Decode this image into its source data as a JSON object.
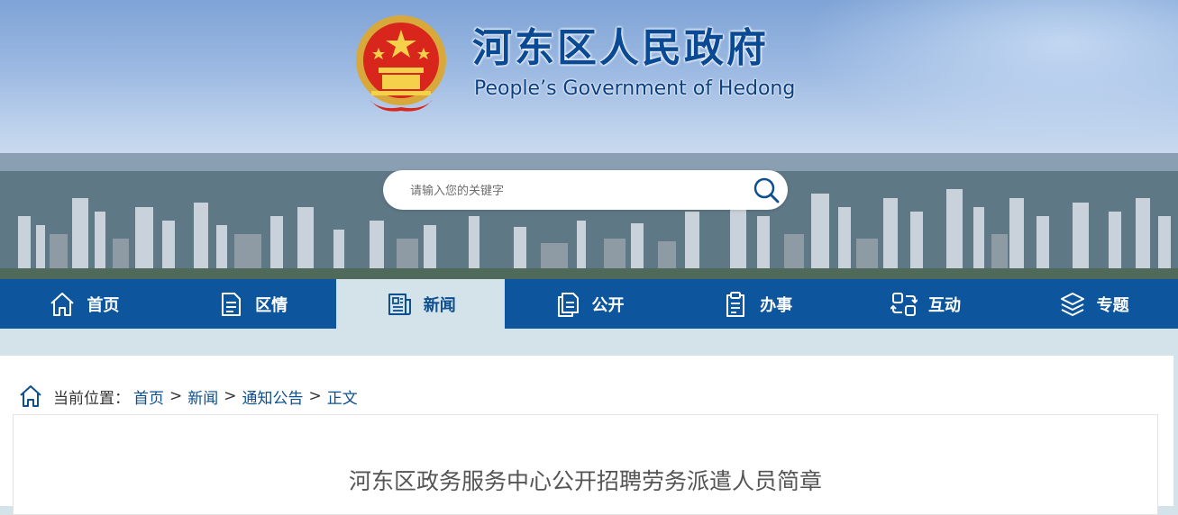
{
  "header": {
    "title": "河东区人民政府",
    "subtitle": "People’s Government of Hedong",
    "emblem_icon": "national-emblem-icon"
  },
  "search": {
    "placeholder": "请输入您的关键字",
    "icon": "search-icon"
  },
  "nav": {
    "items": [
      {
        "label": "首页",
        "icon": "home-icon",
        "active": false
      },
      {
        "label": "区情",
        "icon": "document-icon",
        "active": false
      },
      {
        "label": "新闻",
        "icon": "newspaper-icon",
        "active": true
      },
      {
        "label": "公开",
        "icon": "files-icon",
        "active": false
      },
      {
        "label": "办事",
        "icon": "clipboard-icon",
        "active": false
      },
      {
        "label": "互动",
        "icon": "interaction-icon",
        "active": false
      },
      {
        "label": "专题",
        "icon": "layers-icon",
        "active": false
      }
    ]
  },
  "breadcrumb": {
    "prefix": "当前位置：",
    "items": [
      "首页",
      "新闻",
      "通知公告",
      "正文"
    ],
    "separator": ">"
  },
  "article": {
    "title": "河东区政务服务中心公开招聘劳务派遣人员简章"
  },
  "colors": {
    "nav_bg": "#0d559d",
    "nav_active_bg": "#d3e3e9",
    "title_blue": "#0a4a94",
    "link_blue": "#0d4f8f",
    "page_bg": "#d3e3e9"
  }
}
